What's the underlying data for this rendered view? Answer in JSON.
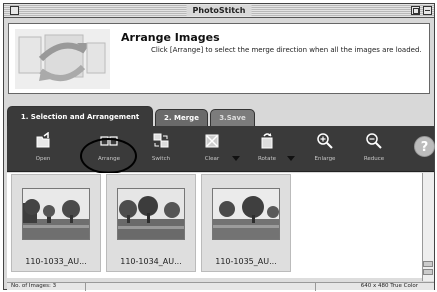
{
  "window": {
    "title": "PhotoStitch"
  },
  "guide": {
    "title": "Arrange Images",
    "text": "Click [Arrange] to select the merge direction when all the images are loaded."
  },
  "tabs": [
    {
      "label": "1. Selection and Arrangement",
      "active": true
    },
    {
      "label": "2. Merge",
      "active": false
    },
    {
      "label": "3.Save",
      "active": false
    }
  ],
  "toolbar": {
    "open_label": "Open",
    "arrange_label": "Arrange",
    "switch_label": "Switch",
    "clear_label": "Clear",
    "rotate_label": "Rotate",
    "enlarge_label": "Enlarge",
    "reduce_label": "Reduce",
    "help_label": "?"
  },
  "thumbnails": [
    {
      "caption": "110-1033_AU..."
    },
    {
      "caption": "110-1034_AU..."
    },
    {
      "caption": "110-1035_AU..."
    }
  ],
  "status": {
    "image_count": "No. of Images: 3",
    "resolution": "640 x 480 True Color"
  },
  "colors": {
    "toolbar_bg": "#3a3a3a",
    "guide_bg": "#ffffff",
    "window_bg": "#d8d8d8"
  }
}
